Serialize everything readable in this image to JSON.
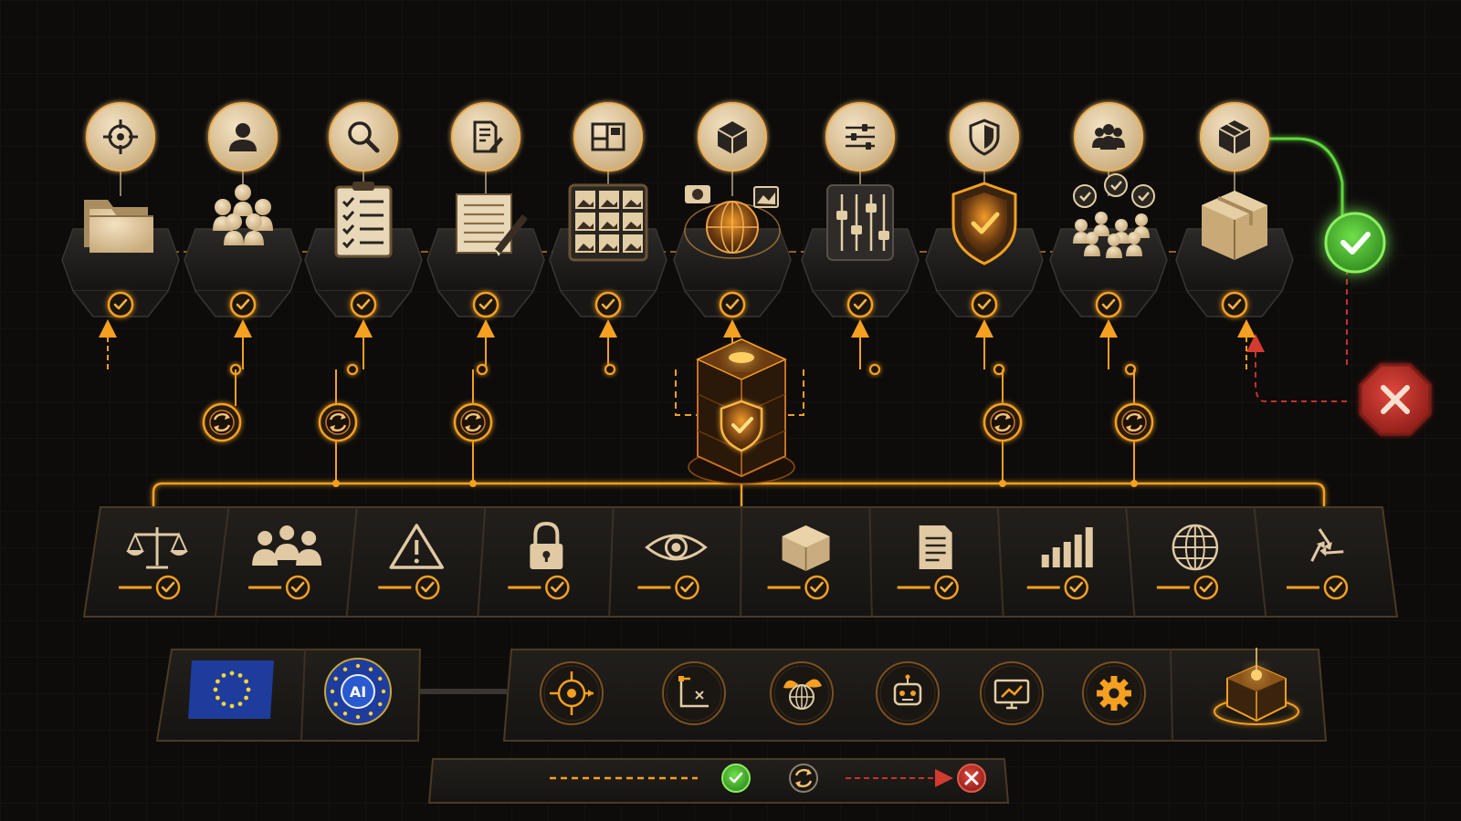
{
  "ai_badge": {
    "label": "AI"
  },
  "colors": {
    "background": "#0d0c0b",
    "grid": "#1b1917",
    "beige": "#e0c9a3",
    "beige_dark": "#b89b6f",
    "orange": "#f5a020",
    "orange_bright": "#ffb640",
    "green": "#5fd63a",
    "red": "#c8322c",
    "eu_blue": "#1e3c9c",
    "eu_star": "#f6d33c",
    "panel": "#1c1a17",
    "panel_border": "#4a3a24",
    "pedestal": "#222020"
  },
  "pipeline_steps": [
    {
      "step_icon": "target-icon",
      "illustration": "folders-icon"
    },
    {
      "step_icon": "person-icon",
      "illustration": "people-group-icon"
    },
    {
      "step_icon": "magnifier-icon",
      "illustration": "checklist-clipboard-icon"
    },
    {
      "step_icon": "document-edit-icon",
      "illustration": "notepad-pencil-icon"
    },
    {
      "step_icon": "layout-grid-icon",
      "illustration": "image-grid-icon"
    },
    {
      "step_icon": "cube-icon",
      "illustration": "globe-camera-icon"
    },
    {
      "step_icon": "sliders-icon",
      "illustration": "mixer-sliders-icon"
    },
    {
      "step_icon": "shield-icon",
      "illustration": "shield-check-icon"
    },
    {
      "step_icon": "users-icon",
      "illustration": "people-approval-icon"
    },
    {
      "step_icon": "package-icon",
      "illustration": "cardboard-box-icon"
    }
  ],
  "outcomes": {
    "approve": "check-circle-icon",
    "reject": "reject-octagon-icon"
  },
  "hub": {
    "icon": "shield-check-core-icon"
  },
  "cycle_nodes": [
    "cycle-icon",
    "cycle-icon",
    "cycle-icon",
    "cycle-icon",
    "cycle-icon"
  ],
  "principles": [
    {
      "icon": "balance-scale-icon"
    },
    {
      "icon": "people-icon"
    },
    {
      "icon": "warning-icon"
    },
    {
      "icon": "padlock-icon"
    },
    {
      "icon": "eye-icon"
    },
    {
      "icon": "box-icon"
    },
    {
      "icon": "document-icon"
    },
    {
      "icon": "bar-chart-icon"
    },
    {
      "icon": "globe-icon"
    },
    {
      "icon": "recycle-icon"
    }
  ],
  "regulation_panel": {
    "items": [
      "eu-flag-icon",
      "ai-badge-icon"
    ]
  },
  "tools_panel": {
    "items": [
      "target-arrows-icon",
      "axes-transform-icon",
      "globe-leaves-icon",
      "robot-icon",
      "monitor-chart-icon",
      "gear-icon",
      "glowing-cube-icon"
    ]
  },
  "legend": {
    "items": [
      "solid-line",
      "dashed-line",
      "approved",
      "iteration",
      "rejected"
    ]
  }
}
